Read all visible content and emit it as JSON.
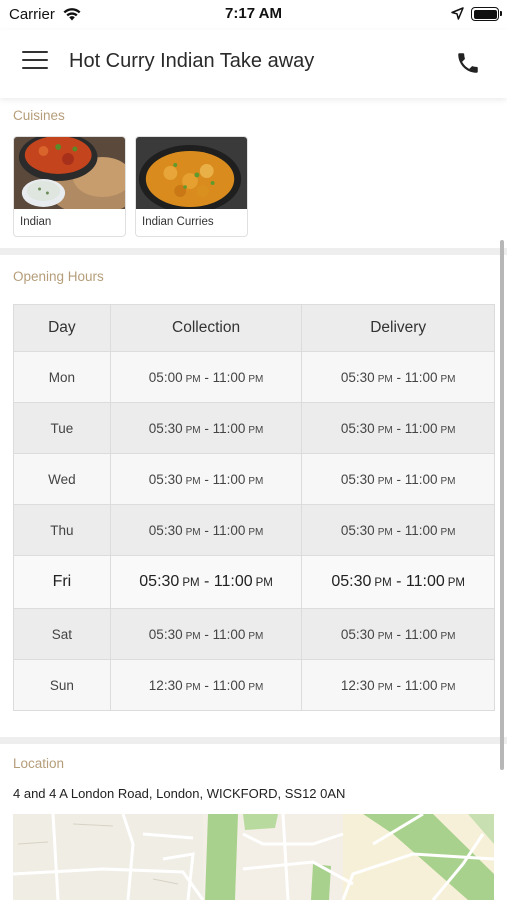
{
  "status_bar": {
    "carrier": "Carrier",
    "time": "7:17 AM"
  },
  "header": {
    "title": "Hot Curry Indian Take away",
    "menu_icon": "hamburger-menu-icon",
    "phone_icon": "phone-icon"
  },
  "cuisines": {
    "label": "Cuisines",
    "items": [
      {
        "name": "Indian"
      },
      {
        "name": "Indian Curries"
      }
    ]
  },
  "opening_hours": {
    "label": "Opening Hours",
    "columns": [
      "Day",
      "Collection",
      "Delivery"
    ],
    "rows": [
      {
        "day": "Mon",
        "collection": {
          "from": "05:00",
          "from_ampm": "PM",
          "to": "11:00",
          "to_ampm": "PM"
        },
        "delivery": {
          "from": "05:30",
          "from_ampm": "PM",
          "to": "11:00",
          "to_ampm": "PM"
        }
      },
      {
        "day": "Tue",
        "collection": {
          "from": "05:30",
          "from_ampm": "PM",
          "to": "11:00",
          "to_ampm": "PM"
        },
        "delivery": {
          "from": "05:30",
          "from_ampm": "PM",
          "to": "11:00",
          "to_ampm": "PM"
        }
      },
      {
        "day": "Wed",
        "collection": {
          "from": "05:30",
          "from_ampm": "PM",
          "to": "11:00",
          "to_ampm": "PM"
        },
        "delivery": {
          "from": "05:30",
          "from_ampm": "PM",
          "to": "11:00",
          "to_ampm": "PM"
        }
      },
      {
        "day": "Thu",
        "collection": {
          "from": "05:30",
          "from_ampm": "PM",
          "to": "11:00",
          "to_ampm": "PM"
        },
        "delivery": {
          "from": "05:30",
          "from_ampm": "PM",
          "to": "11:00",
          "to_ampm": "PM"
        }
      },
      {
        "day": "Fri",
        "collection": {
          "from": "05:30",
          "from_ampm": "PM",
          "to": "11:00",
          "to_ampm": "PM"
        },
        "delivery": {
          "from": "05:30",
          "from_ampm": "PM",
          "to": "11:00",
          "to_ampm": "PM"
        }
      },
      {
        "day": "Sat",
        "collection": {
          "from": "05:30",
          "from_ampm": "PM",
          "to": "11:00",
          "to_ampm": "PM"
        },
        "delivery": {
          "from": "05:30",
          "from_ampm": "PM",
          "to": "11:00",
          "to_ampm": "PM"
        }
      },
      {
        "day": "Sun",
        "collection": {
          "from": "12:30",
          "from_ampm": "PM",
          "to": "11:00",
          "to_ampm": "PM"
        },
        "delivery": {
          "from": "12:30",
          "from_ampm": "PM",
          "to": "11:00",
          "to_ampm": "PM"
        }
      }
    ],
    "highlighted_day": "Fri"
  },
  "location": {
    "label": "Location",
    "address": "4 and 4 A London Road, London, WICKFORD, SS12 0AN"
  },
  "colors": {
    "section_label": "#b59d7a",
    "table_header_bg": "#ececec",
    "map_green": "#a9d18e",
    "map_road": "#ffffff"
  }
}
